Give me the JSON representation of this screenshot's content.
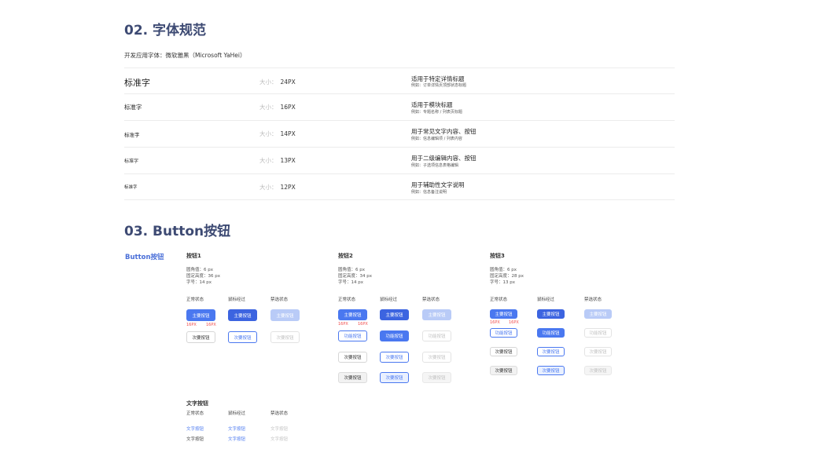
{
  "sections": {
    "font_title": "02. 字体规范",
    "font_intro": "开发应用字体：微软雅黑（Microsoft YaHei）",
    "button_title": "03. Button按钮"
  },
  "font_rows": [
    {
      "name": "标准字",
      "size_label": "大小：",
      "size": "24PX",
      "usage": "适用于特定详情标题",
      "example": "例如：订单详情页顶部状态标题"
    },
    {
      "name": "标准字",
      "size_label": "大小：",
      "size": "16PX",
      "usage": "适用于模块标题",
      "example": "例如：专题名称 / 列表页标题"
    },
    {
      "name": "标准字",
      "size_label": "大小：",
      "size": "14PX",
      "usage": "用于常见文字内容、按钮",
      "example": "例如：信息编辑项 / 列表内容"
    },
    {
      "name": "标准字",
      "size_label": "大小：",
      "size": "13PX",
      "usage": "用于二级编辑内容、按钮",
      "example": "例如：子选项信息表格编辑"
    },
    {
      "name": "标准字",
      "size_label": "大小：",
      "size": "12PX",
      "usage": "用于辅助性文字说明",
      "example": "例如：信息备注说明"
    }
  ],
  "buttons": {
    "side_title": "Button按钮",
    "states": {
      "normal": "正常状态",
      "hover": "鼠标经过",
      "disabled": "禁选状态"
    },
    "labels": {
      "primary": "主要按钮",
      "secondary": "次要按钮",
      "function": "功能按钮",
      "text": "文字按钮"
    },
    "padding_label": "16PX",
    "group1": {
      "title": "按钮1",
      "radius": "圆角值：6 px",
      "height": "固定高度：36 px",
      "font": "字号：14 px"
    },
    "group2": {
      "title": "按钮2",
      "radius": "圆角值：6 px",
      "height": "固定高度：34 px",
      "font": "字号：14 px"
    },
    "group3": {
      "title": "按钮3",
      "radius": "圆角值：6 px",
      "height": "固定高度：28 px",
      "font": "字号：13 px"
    },
    "text_group": {
      "title": "文字按钮"
    }
  },
  "colors": {
    "title": "#3d4a73",
    "primary": "#4a78f0",
    "primary_disabled": "#b9cbf7",
    "dimension_red": "#f04b4b"
  }
}
